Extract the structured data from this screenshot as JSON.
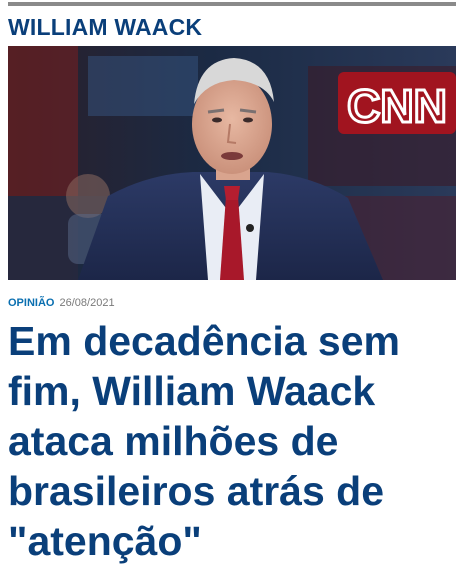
{
  "section": {
    "title": "WILLIAM WAACK"
  },
  "hero": {
    "logo_text": "CNN"
  },
  "article": {
    "category": "OPINIÃO",
    "date": "26/08/2021",
    "headline": "Em decadência sem fim, William Waack ataca milhões de brasileiros atrás de \"atenção\""
  },
  "colors": {
    "accent": "#0a3f7a",
    "category": "#0a6fb0",
    "date": "#7a7a7a",
    "rule": "#8a8a8a"
  }
}
